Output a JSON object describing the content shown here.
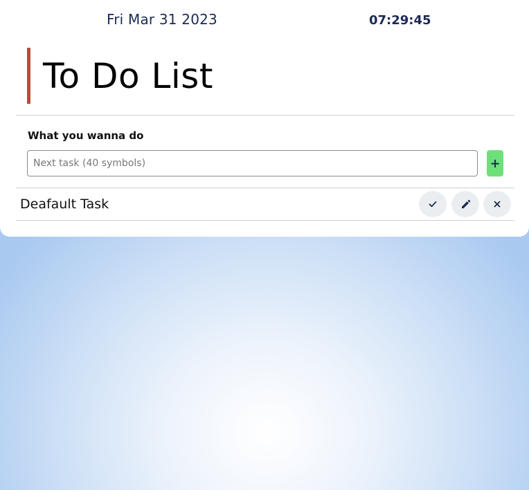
{
  "header": {
    "date": "Fri Mar 31 2023",
    "time": "07:29:45"
  },
  "title": "To Do List",
  "form": {
    "label": "What you wanna do",
    "placeholder": "Next task (40 symbols)",
    "value": "",
    "add_label": "+"
  },
  "tasks": [
    {
      "text": "Deafault Task",
      "actions": [
        "check-icon",
        "pencil-icon",
        "close-icon"
      ]
    }
  ],
  "colors": {
    "title_accent": "#c0473d",
    "add_button": "#6ee07a",
    "text_dark": "#1a2a55",
    "action_button_bg": "#ebeef0",
    "background_light": "#ffffff",
    "background_edge": "#a9c9f0"
  }
}
